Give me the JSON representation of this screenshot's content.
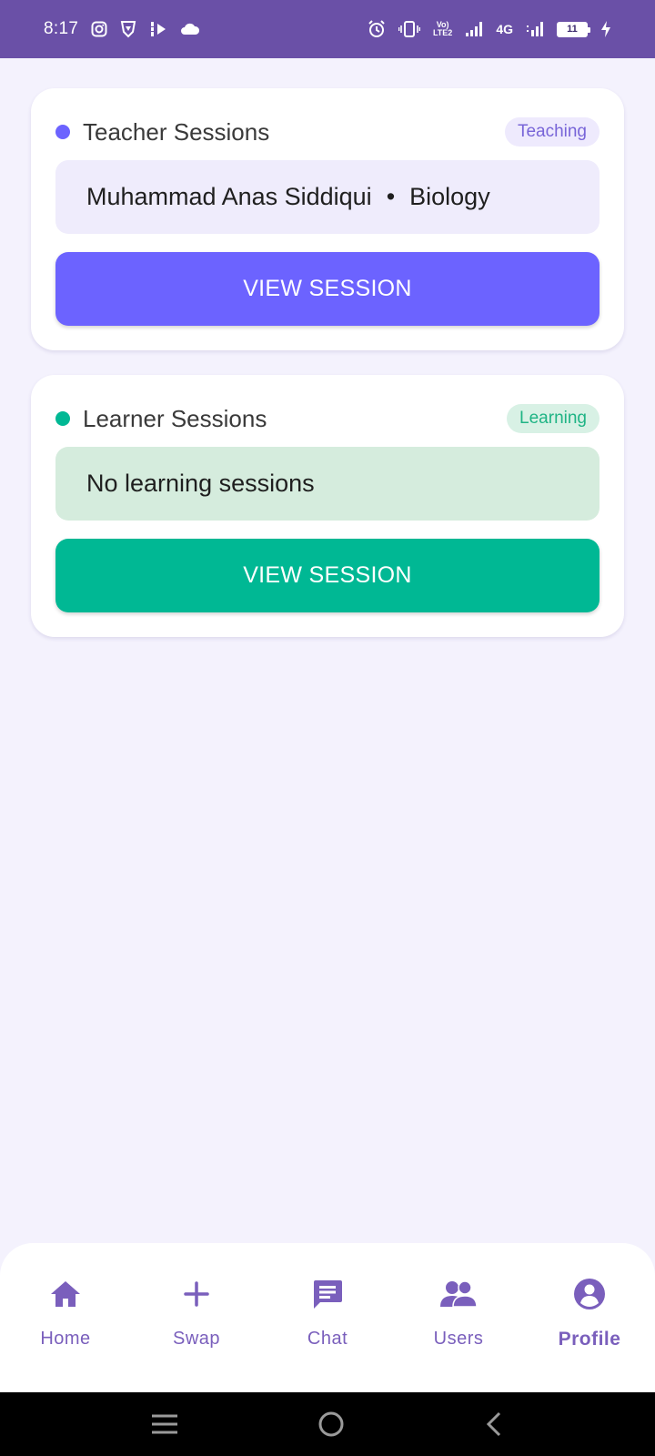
{
  "status_bar": {
    "time": "8:17",
    "network": "4G",
    "volte_top": "Vo)",
    "volte_bottom": "LTE2",
    "battery": "11"
  },
  "colors": {
    "accent_teacher": "#6c63ff",
    "accent_learner": "#00b894",
    "nav_color": "#7a5fbc",
    "status_bar": "#6a50a7"
  },
  "teacher_card": {
    "title": "Teacher Sessions",
    "badge": "Teaching",
    "teacher_name": "Muhammad Anas Siddiqui",
    "separator": "•",
    "subject": "Biology",
    "button": "VIEW SESSION"
  },
  "learner_card": {
    "title": "Learner Sessions",
    "badge": "Learning",
    "message": "No learning sessions",
    "button": "VIEW SESSION"
  },
  "bottom_nav": {
    "items": [
      {
        "label": "Home",
        "icon": "home-icon"
      },
      {
        "label": "Swap",
        "icon": "plus-icon"
      },
      {
        "label": "Chat",
        "icon": "chat-icon"
      },
      {
        "label": "Users",
        "icon": "users-icon"
      },
      {
        "label": "Profile",
        "icon": "profile-icon",
        "active": true
      }
    ]
  }
}
